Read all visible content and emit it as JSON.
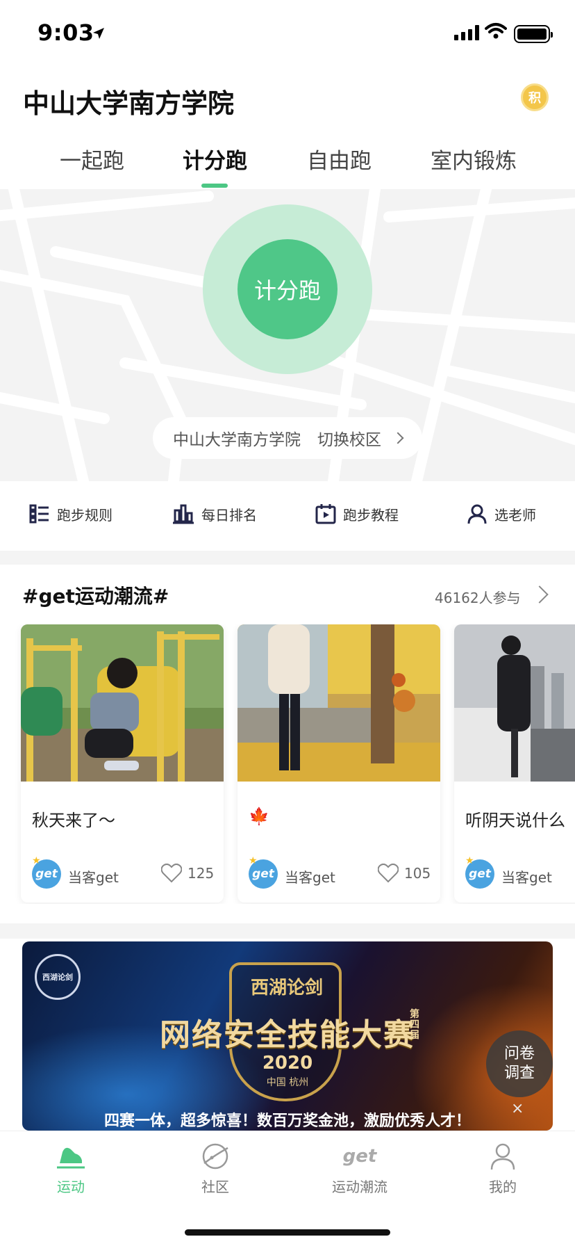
{
  "status_bar": {
    "time": "9:03"
  },
  "header": {
    "campus": "中山大学南方学院",
    "points_badge": "积"
  },
  "tabs": [
    {
      "label": "一起跑"
    },
    {
      "label": "计分跑",
      "active": true
    },
    {
      "label": "自由跑"
    },
    {
      "label": "室内锻炼"
    }
  ],
  "run": {
    "button_label": "计分跑"
  },
  "campus_switch": {
    "campus_name": "中山大学南方学院",
    "switch_label": "切换校区"
  },
  "quick_actions": [
    {
      "label": "跑步规则",
      "icon": "list-rules-icon"
    },
    {
      "label": "每日排名",
      "icon": "bar-ranking-icon"
    },
    {
      "label": "跑步教程",
      "icon": "calendar-play-icon"
    },
    {
      "label": "选老师",
      "icon": "person-icon"
    }
  ],
  "topic": {
    "title": "#get运动潮流#",
    "participants": "46162人参与"
  },
  "posts": [
    {
      "title": "秋天来了～",
      "author": "当客get",
      "likes": "125",
      "avatar_text": "get"
    },
    {
      "title": "🍁",
      "author": "当客get",
      "likes": "105",
      "avatar_text": "get"
    },
    {
      "title": "听阴天说什么",
      "author": "当客get",
      "likes": "",
      "avatar_text": "get"
    }
  ],
  "banner": {
    "title_top": "西湖论剑",
    "title_main": "网络安全技能大赛",
    "edition": "第四届",
    "year": "2020",
    "city": "中国 杭州",
    "tagline": "四赛一体，超多惊喜！数百万奖金池，激励优秀人才！",
    "seal_text": "西湖论剑"
  },
  "survey": {
    "label_line1": "问卷",
    "label_line2": "调查",
    "close": "×"
  },
  "bottom_nav": [
    {
      "label": "运动",
      "active": true
    },
    {
      "label": "社区"
    },
    {
      "label": "运动潮流",
      "icon_text": "get"
    },
    {
      "label": "我的"
    }
  ],
  "colors": {
    "accent": "#4cc784",
    "accent_light": "#c6ecd6",
    "badge": "#f3c64a",
    "avatar": "#4aa3e0"
  }
}
